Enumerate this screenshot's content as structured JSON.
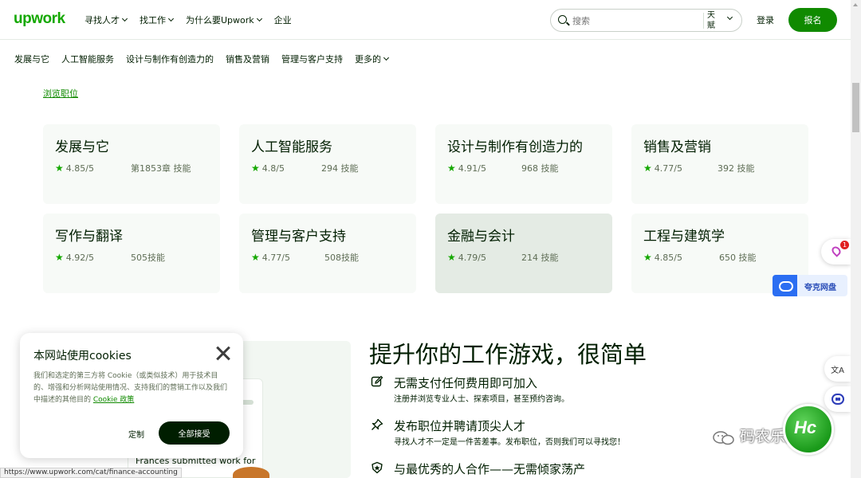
{
  "header": {
    "logo": "upwork",
    "nav": [
      {
        "label": "寻找人才"
      },
      {
        "label": "找工作"
      },
      {
        "label": "为什么要Upwork"
      },
      {
        "label": "企业"
      }
    ],
    "search_placeholder": "搜索",
    "search_scope": "天赋",
    "login": "登录",
    "signup": "报名"
  },
  "categories_bar": [
    {
      "label": "发展与它"
    },
    {
      "label": "人工智能服务"
    },
    {
      "label": "设计与制作有创造力的"
    },
    {
      "label": "销售及营销"
    },
    {
      "label": "管理与客户支持"
    },
    {
      "label": "更多的"
    }
  ],
  "browse_link": "浏览职位",
  "cards": [
    {
      "title": "发展与它",
      "rating": "4.85/5",
      "skills": "第1853章 技能"
    },
    {
      "title": "人工智能服务",
      "rating": "4.8/5",
      "skills": "294 技能"
    },
    {
      "title": "设计与制作有创造力的",
      "rating": "4.91/5",
      "skills": "968 技能"
    },
    {
      "title": "销售及营销",
      "rating": "4.77/5",
      "skills": "392 技能"
    },
    {
      "title": "写作与翻译",
      "rating": "4.92/5",
      "skills": "505技能"
    },
    {
      "title": "管理与客户支持",
      "rating": "4.77/5",
      "skills": "508技能"
    },
    {
      "title": "金融与会计",
      "rating": "4.79/5",
      "skills": "214 技能"
    },
    {
      "title": "工程与建筑学",
      "rating": "4.85/5",
      "skills": "650 技能"
    }
  ],
  "promo": {
    "headline": "提升你的工作游戏，很简单",
    "card_text": "Frances submitted work for",
    "features": [
      {
        "title": "无需支付任何费用即可加入",
        "desc": "注册并浏览专业人士、探索项目，甚至预约咨询。",
        "icon": "edit-icon"
      },
      {
        "title": "发布职位并聘请顶尖人才",
        "desc": "寻找人才不一定是一件苦差事。发布职位，否则我们可以寻找您！",
        "icon": "pin-icon"
      },
      {
        "title": "与最优秀的人合作——无需倾家荡产",
        "desc": "",
        "icon": "shield-icon"
      }
    ]
  },
  "cookie": {
    "title": "本网站使用cookies",
    "body": "我们和选定的第三方将 Cookie（或类似技术）用于技术目的、增强和分析网站使用情况、支持我们的营销工作以及我们中描述的其他目的",
    "link": "Cookie 政策",
    "customize": "定制",
    "accept": "全部接受"
  },
  "status_url": "https://www.upwork.com/cat/finance-accounting",
  "widgets": {
    "badge_count": "1",
    "cloud_label": "夸克网盘",
    "translate_glyph": "文A"
  },
  "watermark": {
    "text": "码农乐园",
    "badge": "Hc"
  },
  "colors": {
    "brand_green": "#14a800",
    "button_green": "#108a00",
    "dark": "#001e00",
    "card_bg": "#f7faf7",
    "card_active_bg": "#e4ebe4"
  }
}
